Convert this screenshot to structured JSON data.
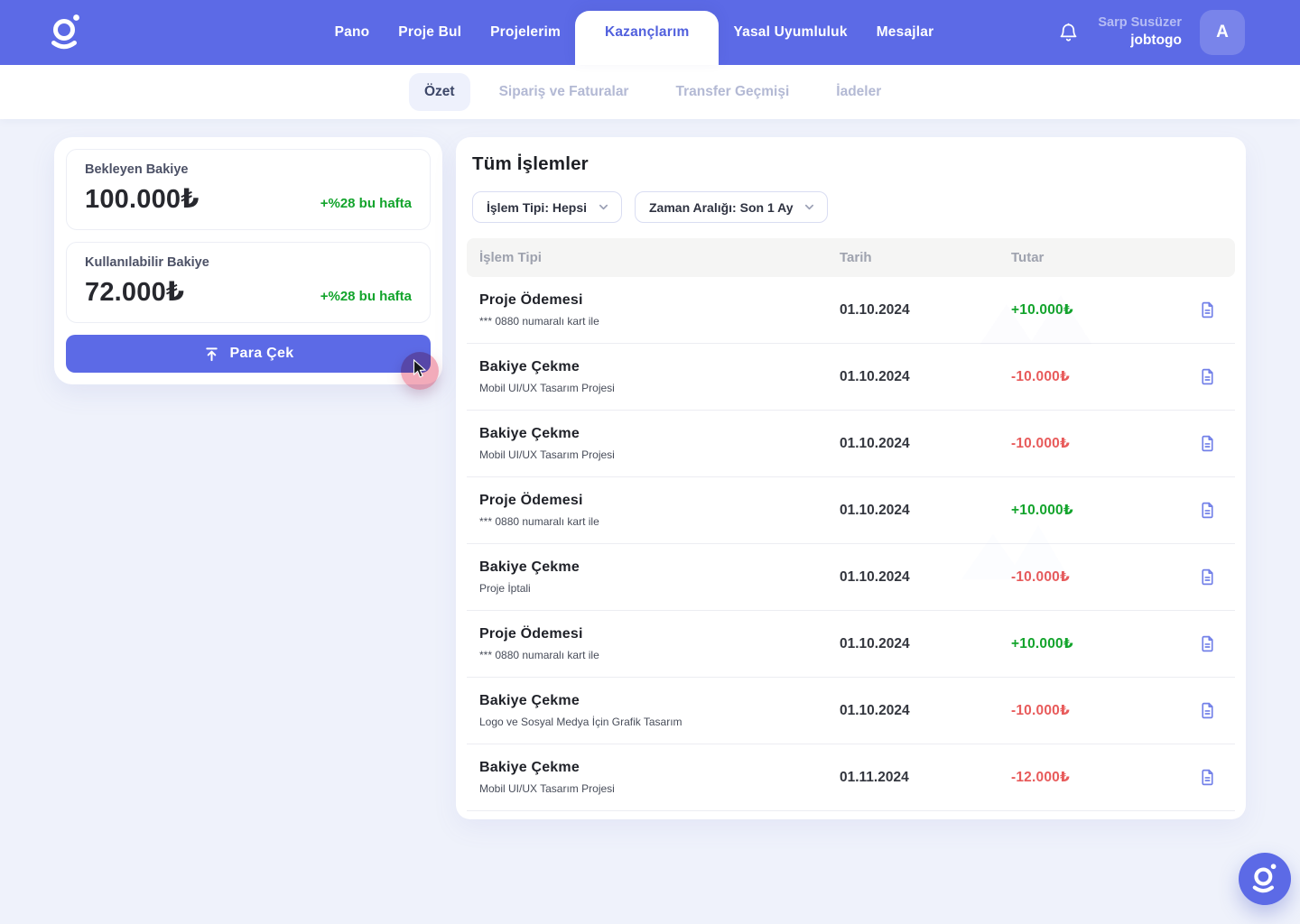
{
  "navbar": {
    "brand_logo": "jobtogo-logo",
    "items": [
      {
        "id": "pano",
        "label": "Pano",
        "active": false
      },
      {
        "id": "proje-bul",
        "label": "Proje Bul",
        "active": false
      },
      {
        "id": "projelerim",
        "label": "Projelerim",
        "active": false
      },
      {
        "id": "kazanclarim",
        "label": "Kazançlarım",
        "active": true
      },
      {
        "id": "yasal-uyumluluk",
        "label": "Yasal Uyumluluk",
        "active": false
      },
      {
        "id": "mesajlar",
        "label": "Mesajlar",
        "active": false
      }
    ],
    "user": {
      "name": "Sarp Susüzer",
      "company": "jobtogo",
      "avatar_initial": "A"
    }
  },
  "tabs": [
    {
      "id": "ozet",
      "label": "Özet",
      "active": true
    },
    {
      "id": "siparis-ve-faturalar",
      "label": "Sipariş ve Faturalar",
      "active": false
    },
    {
      "id": "transfer-gecmisi",
      "label": "Transfer Geçmişi",
      "active": false
    },
    {
      "id": "iadeler",
      "label": "İadeler",
      "active": false
    }
  ],
  "balances": {
    "pending": {
      "label": "Bekleyen Bakiye",
      "amount": "100.000₺",
      "delta": "+%28 bu hafta"
    },
    "available": {
      "label": "Kullanılabilir Bakiye",
      "amount": "72.000₺",
      "delta": "+%28 bu hafta"
    },
    "withdraw_label": "Para Çek"
  },
  "transactions": {
    "title": "Tüm İşlemler",
    "filters": [
      {
        "id": "islem-tipi",
        "label": "İşlem Tipi: Hepsi"
      },
      {
        "id": "zaman-araligi",
        "label": "Zaman Aralığı: Son 1 Ay"
      }
    ],
    "columns": [
      "İşlem Tipi",
      "Tarih",
      "Tutar"
    ],
    "rows": [
      {
        "type": "Proje Ödemesi",
        "detail": "*** 0880 numaralı kart ile",
        "date": "01.10.2024",
        "amount": "+10.000₺",
        "direction": "in"
      },
      {
        "type": "Bakiye Çekme",
        "detail": "Mobil UI/UX Tasarım Projesi",
        "date": "01.10.2024",
        "amount": "-10.000₺",
        "direction": "out"
      },
      {
        "type": "Bakiye Çekme",
        "detail": "Mobil UI/UX Tasarım Projesi",
        "date": "01.10.2024",
        "amount": "-10.000₺",
        "direction": "out"
      },
      {
        "type": "Proje Ödemesi",
        "detail": "*** 0880 numaralı kart ile",
        "date": "01.10.2024",
        "amount": "+10.000₺",
        "direction": "in"
      },
      {
        "type": "Bakiye Çekme",
        "detail": "Proje İptali",
        "date": "01.10.2024",
        "amount": "-10.000₺",
        "direction": "out"
      },
      {
        "type": "Proje Ödemesi",
        "detail": "*** 0880 numaralı kart ile",
        "date": "01.10.2024",
        "amount": "+10.000₺",
        "direction": "in"
      },
      {
        "type": "Bakiye Çekme",
        "detail": "Logo ve Sosyal Medya İçin Grafik Tasarım",
        "date": "01.10.2024",
        "amount": "-10.000₺",
        "direction": "out"
      },
      {
        "type": "Bakiye Çekme",
        "detail": "Mobil UI/UX Tasarım Projesi",
        "date": "01.11.2024",
        "amount": "-12.000₺",
        "direction": "out"
      }
    ]
  },
  "icons": {
    "brand": "jobtogo-logo",
    "notifications": "bell-icon",
    "withdraw": "upload-icon",
    "receipt": "document-icon",
    "dropdown": "chevron-down-icon",
    "pointer": "cursor-icon"
  },
  "colors": {
    "accent": "#5C6AE6",
    "page_background": "#EFF2FB",
    "positive": "#13A42C",
    "negative": "#E85B5B",
    "muted_tab": "#B3B9D4",
    "table_header_bg": "#F5F5F4",
    "click_indicator": "#F1A6B6"
  }
}
